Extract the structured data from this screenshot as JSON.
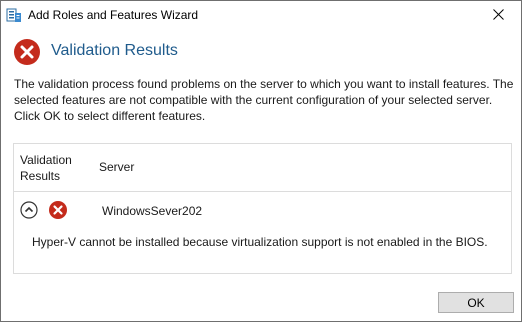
{
  "window": {
    "title": "Add Roles and Features Wizard",
    "icons": {
      "app": "server-manager-icon",
      "close": "close-icon"
    }
  },
  "header": {
    "title": "Validation Results",
    "icon": "error-icon",
    "accent_color": "#1f5b8c",
    "error_color": "#c42b1c"
  },
  "description": "The validation process found problems on the server to which you want to install features. The selected features are not compatible with the current configuration of your selected server.  Click OK to select different features.",
  "results": {
    "columns": [
      "Validation Results",
      "Server"
    ],
    "rows": [
      {
        "server": "WindowsSever202",
        "status_icon": "error-icon",
        "expanded": true,
        "message": "Hyper-V cannot be installed because virtualization support is not enabled in the BIOS."
      }
    ]
  },
  "buttons": {
    "ok": "OK"
  }
}
